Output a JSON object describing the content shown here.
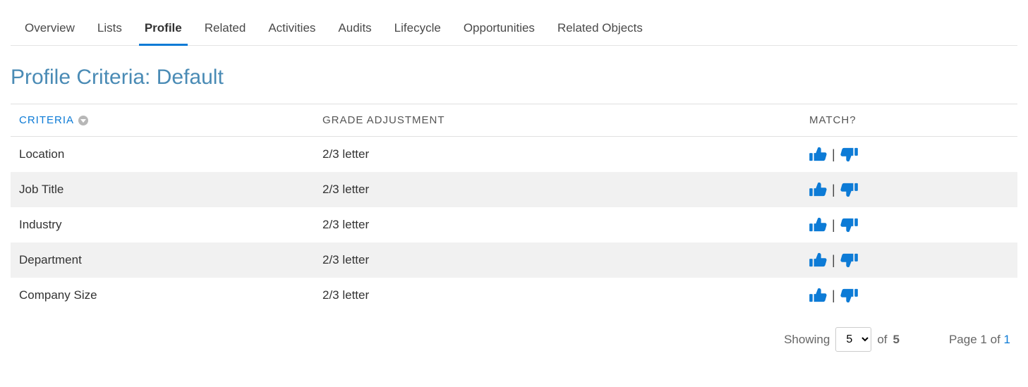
{
  "tabs": [
    {
      "label": "Overview",
      "active": false
    },
    {
      "label": "Lists",
      "active": false
    },
    {
      "label": "Profile",
      "active": true
    },
    {
      "label": "Related",
      "active": false
    },
    {
      "label": "Activities",
      "active": false
    },
    {
      "label": "Audits",
      "active": false
    },
    {
      "label": "Lifecycle",
      "active": false
    },
    {
      "label": "Opportunities",
      "active": false
    },
    {
      "label": "Related Objects",
      "active": false
    }
  ],
  "title": "Profile Criteria: Default",
  "columns": {
    "criteria": "Criteria",
    "adjustment": "Grade Adjustment",
    "match": "Match?"
  },
  "rows": [
    {
      "criteria": "Location",
      "adjustment": "2/3 letter"
    },
    {
      "criteria": "Job Title",
      "adjustment": "2/3 letter"
    },
    {
      "criteria": "Industry",
      "adjustment": "2/3 letter"
    },
    {
      "criteria": "Department",
      "adjustment": "2/3 letter"
    },
    {
      "criteria": "Company Size",
      "adjustment": "2/3 letter"
    }
  ],
  "footer": {
    "showing_label": "Showing",
    "page_size": "5",
    "of_label": "of",
    "total": "5",
    "page_label_prefix": "Page",
    "page_current": "1",
    "page_of": "of",
    "page_total": "1"
  }
}
